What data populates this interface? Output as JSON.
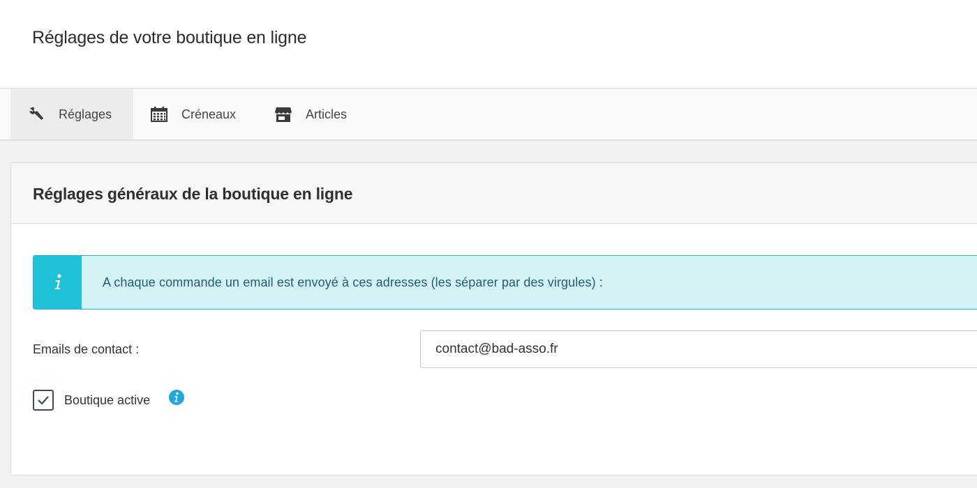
{
  "header": {
    "title": "Réglages de votre boutique en ligne"
  },
  "tabs": [
    {
      "label": "Réglages",
      "icon": "wrench-icon",
      "active": true
    },
    {
      "label": "Créneaux",
      "icon": "calendar-icon",
      "active": false
    },
    {
      "label": "Articles",
      "icon": "store-icon",
      "active": false
    }
  ],
  "card": {
    "title": "Réglages généraux de la boutique en ligne",
    "info": {
      "icon": "info-icon",
      "text": "A chaque commande un email est envoyé à ces adresses (les séparer par des virgules) :"
    },
    "emails": {
      "label": "Emails de contact :",
      "value": "contact@bad-asso.fr"
    },
    "shop_active": {
      "label": "Boutique active",
      "checked": true,
      "help_icon": "info-circle-icon"
    }
  },
  "colors": {
    "accent": "#1ec1d8",
    "info_background": "#d5f2f6",
    "info_text": "#1f5f73"
  }
}
